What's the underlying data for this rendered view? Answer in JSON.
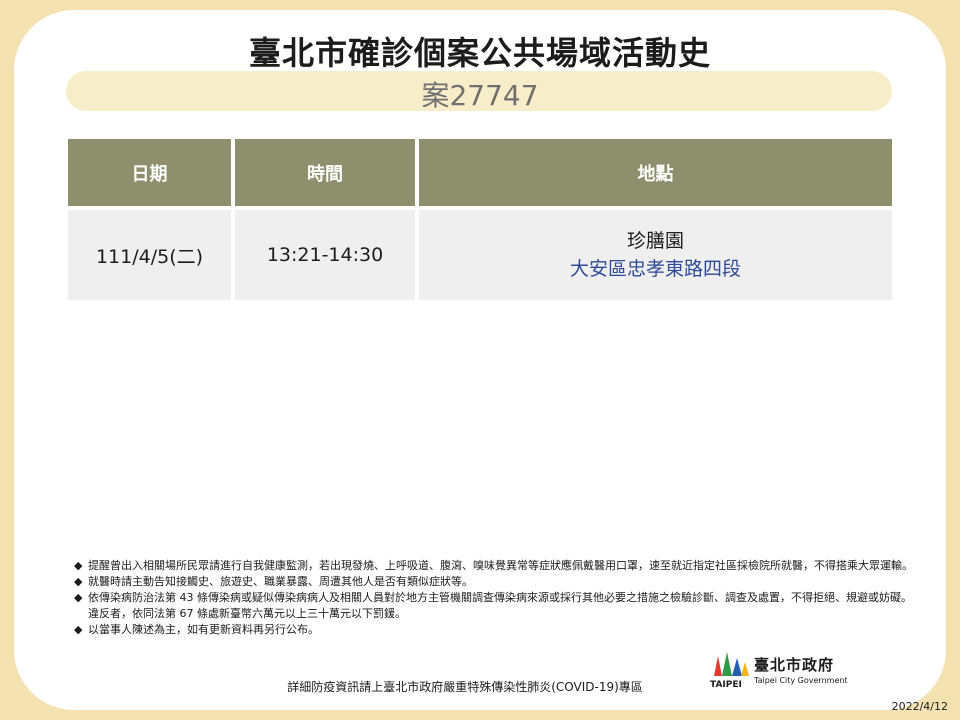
{
  "title": "臺北市確診個案公共場域活動史",
  "case_label": "案27747",
  "table": {
    "headers": [
      "日期",
      "時間",
      "地點"
    ],
    "rows": [
      {
        "date": "111/4/5(二)",
        "time": "13:21-14:30",
        "place_name": "珍膳園",
        "place_address": "大安區忠孝東路四段"
      }
    ]
  },
  "notes": {
    "bullet": "◆",
    "items": [
      "提醒曾出入相關場所民眾請進行自我健康監測，若出現發燒、上呼吸道、腹瀉、嗅味覺異常等症狀應佩戴醫用口罩，速至就近指定社區採檢院所就醫，不得搭乘大眾運輸。",
      "就醫時請主動告知接觸史、旅遊史、職業暴露、周遭其他人是否有類似症狀等。",
      "依傳染病防治法第 43 條傳染病或疑似傳染病病人及相關人員對於地方主管機關調查傳染病來源或採行其他必要之措施之檢驗診斷、調查及處置，不得拒絕、規避或妨礙。違反者，依同法第 67 條處新臺幣六萬元以上三十萬元以下罰鍰。",
      "以當事人陳述為主，如有更新資料再另行公布。"
    ]
  },
  "footer": "詳細防疫資訊請上臺北市政府嚴重特殊傳染性肺炎(COVID-19)專區",
  "logo": {
    "name_zh": "臺北市政府",
    "name_en": "Taipei City Government",
    "wordmark": "TAIPEI",
    "icon": "taipei-city-logo-icon"
  },
  "date": "2022/4/12",
  "colors": {
    "background": "#f3e2b0",
    "header": "#8e8f6c",
    "row": "#efefef",
    "address": "#2e4a9a",
    "case_bar": "#f7edc9"
  }
}
